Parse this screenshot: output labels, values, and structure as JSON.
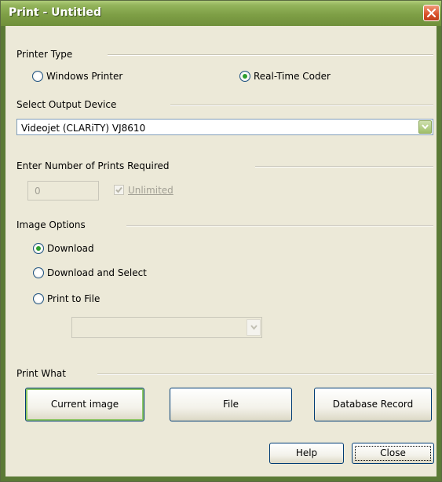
{
  "window": {
    "title": "Print - Untitled"
  },
  "printer_type": {
    "label": "Printer Type",
    "options": [
      "Windows Printer",
      "Real-Time Coder"
    ],
    "selected": "Real-Time Coder"
  },
  "output_device": {
    "label": "Select Output Device",
    "value": "Videojet (CLARiTY) VJ8610"
  },
  "prints": {
    "label": "Enter Number of Prints Required",
    "value": "0",
    "unlimited_label": "Unlimited",
    "unlimited_checked": true
  },
  "image_options": {
    "label": "Image Options",
    "options": [
      "Download",
      "Download and Select",
      "Print to File"
    ],
    "selected": "Download",
    "file_select_value": ""
  },
  "print_what": {
    "label": "Print What",
    "buttons": [
      "Current image",
      "File",
      "Database Record"
    ]
  },
  "footer": {
    "help_label": "Help",
    "close_label": "Close"
  },
  "colors": {
    "title_bar": "#7e9f46",
    "dialog_bg": "#ece9d8",
    "close_button": "#d9502a",
    "radio_dot": "#2e9e2e"
  }
}
